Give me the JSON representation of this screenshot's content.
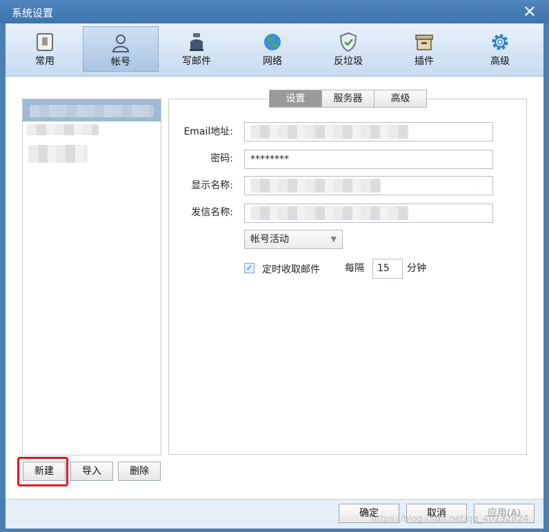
{
  "window": {
    "title": "系统设置",
    "close_symbol": "✕"
  },
  "toolbar": {
    "items": [
      {
        "label": "常用",
        "icon": "switch-icon"
      },
      {
        "label": "帐号",
        "icon": "user-icon"
      },
      {
        "label": "写邮件",
        "icon": "inkwell-icon"
      },
      {
        "label": "网络",
        "icon": "globe-icon"
      },
      {
        "label": "反垃圾",
        "icon": "shield-icon"
      },
      {
        "label": "插件",
        "icon": "box-icon"
      },
      {
        "label": "高级",
        "icon": "gear-icon"
      }
    ],
    "active_index": 1
  },
  "tabs": [
    {
      "label": "设置",
      "active": true
    },
    {
      "label": "服务器",
      "active": false
    },
    {
      "label": "高级",
      "active": false
    }
  ],
  "form": {
    "email_label": "Email地址:",
    "password_label": "密码:",
    "password_value": "********",
    "display_name_label": "显示名称:",
    "sender_name_label": "发信名称:",
    "account_status": "帐号活动",
    "auto_fetch_label": "定时收取邮件",
    "auto_fetch_checked": true,
    "interval_prefix": "每隔",
    "interval_value": "15",
    "interval_unit": "分钟"
  },
  "account_buttons": {
    "new": "新建",
    "import": "导入",
    "delete": "删除"
  },
  "footer": {
    "ok": "确定",
    "cancel": "取消",
    "apply": "应用(A)",
    "watermark": "https://blog.csdn.net/qq_40232824"
  },
  "colors": {
    "titlebar": "#4a7fb4",
    "selected_account": "#9fb8d6",
    "highlight": "#e8141a",
    "active_tab": "#9a9a9a"
  }
}
